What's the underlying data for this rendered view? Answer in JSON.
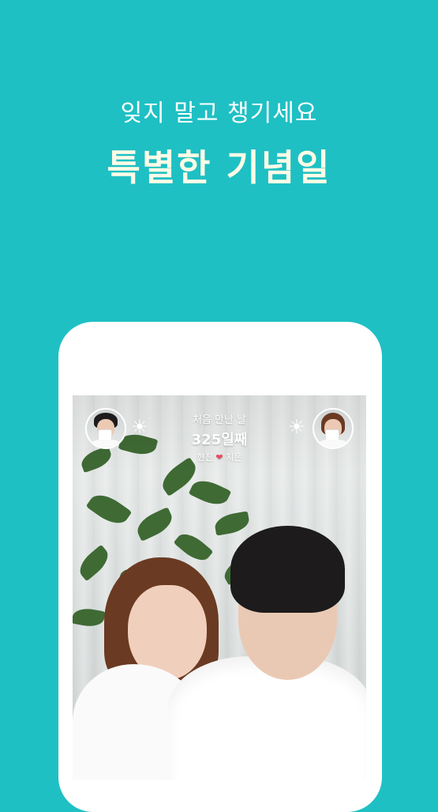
{
  "promo": {
    "subtitle": "잊지 말고 챙기세요",
    "title": "특별한 기념일"
  },
  "anniversary": {
    "label": "처음 만난 날",
    "days": "325일째",
    "name_left": "현진",
    "heart_icon": "❤",
    "name_right": "지은"
  },
  "icons": {
    "left_weather": "sun-icon",
    "right_weather": "sun-icon"
  },
  "colors": {
    "background": "#1ec0c4",
    "title": "#fffbe6",
    "heart": "#e84a5f"
  }
}
